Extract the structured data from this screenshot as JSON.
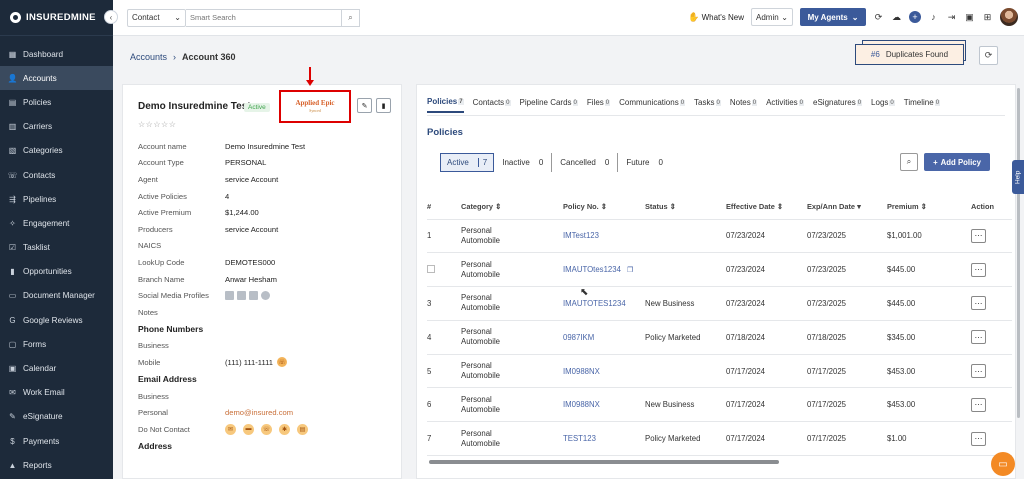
{
  "app": {
    "logo_text": "INSUREDMINE"
  },
  "sidebar": {
    "items": [
      {
        "label": "Dashboard",
        "icon": "dashboard-icon",
        "glyph": "▦"
      },
      {
        "label": "Accounts",
        "icon": "accounts-icon",
        "glyph": "👤",
        "active": true
      },
      {
        "label": "Policies",
        "icon": "policies-icon",
        "glyph": "▤"
      },
      {
        "label": "Carriers",
        "icon": "carriers-icon",
        "glyph": "▥"
      },
      {
        "label": "Categories",
        "icon": "categories-icon",
        "glyph": "▧"
      },
      {
        "label": "Contacts",
        "icon": "contacts-icon",
        "glyph": "☏"
      },
      {
        "label": "Pipelines",
        "icon": "pipelines-icon",
        "glyph": "⇶"
      },
      {
        "label": "Engagement",
        "icon": "engagement-icon",
        "glyph": "✧"
      },
      {
        "label": "Tasklist",
        "icon": "tasklist-icon",
        "glyph": "☑"
      },
      {
        "label": "Opportunities",
        "icon": "opportunities-icon",
        "glyph": "▮"
      },
      {
        "label": "Document Manager",
        "icon": "folder-icon",
        "glyph": "▭"
      },
      {
        "label": "Google Reviews",
        "icon": "google-icon",
        "glyph": "G"
      },
      {
        "label": "Forms",
        "icon": "forms-icon",
        "glyph": "▢"
      },
      {
        "label": "Calendar",
        "icon": "calendar-icon",
        "glyph": "▣"
      },
      {
        "label": "Work Email",
        "icon": "mail-icon",
        "glyph": "✉"
      },
      {
        "label": "eSignature",
        "icon": "signature-icon",
        "glyph": "✎"
      },
      {
        "label": "Payments",
        "icon": "payments-icon",
        "glyph": "$"
      },
      {
        "label": "Reports",
        "icon": "reports-icon",
        "glyph": "▲"
      }
    ]
  },
  "topbar": {
    "contact_select": "Contact",
    "search_placeholder": "Smart Search",
    "whats_new": "What's New",
    "admin_select": "Admin",
    "my_agents": "My Agents"
  },
  "breadcrumb": {
    "parent": "Accounts",
    "separator": "›",
    "current": "Account 360"
  },
  "duplicates": {
    "count": "#6",
    "label": "Duplicates Found"
  },
  "account": {
    "name": "Demo Insuredmine Test",
    "status": "Active",
    "stars": "☆☆☆☆☆",
    "carrier_logo_text": "Applied Epic",
    "carrier_logo_sub": "Synced",
    "fields": [
      {
        "k": "Account name",
        "v": "Demo Insuredmine Test"
      },
      {
        "k": "Account Type",
        "v": "PERSONAL"
      },
      {
        "k": "Agent",
        "v": "service Account"
      },
      {
        "k": "Active Policies",
        "v": "4"
      },
      {
        "k": "Active Premium",
        "v": "$1,244.00"
      },
      {
        "k": "Producers",
        "v": "service Account"
      },
      {
        "k": "NAICS",
        "v": ""
      },
      {
        "k": "LookUp Code",
        "v": "DEMOTES000"
      },
      {
        "k": "Branch Name",
        "v": "Anwar Hesham"
      },
      {
        "k": "Social Media Profiles",
        "v": ""
      },
      {
        "k": "Notes",
        "v": ""
      }
    ],
    "phone_section": "Phone Numbers",
    "phone_business": "Business",
    "phone_mobile_label": "Mobile",
    "phone_mobile": "(111) 111-1111",
    "email_section": "Email Address",
    "email_business": "Business",
    "email_personal_label": "Personal",
    "email_personal": "demo@insured.com",
    "dnc_label": "Do Not Contact",
    "address_section": "Address"
  },
  "tabs": [
    {
      "label": "Policies",
      "count": "7",
      "active": true
    },
    {
      "label": "Contacts",
      "count": "0"
    },
    {
      "label": "Pipeline Cards",
      "count": "0"
    },
    {
      "label": "Files",
      "count": "0"
    },
    {
      "label": "Communications",
      "count": "0"
    },
    {
      "label": "Tasks",
      "count": "0"
    },
    {
      "label": "Notes",
      "count": "0"
    },
    {
      "label": "Activities",
      "count": "0"
    },
    {
      "label": "eSignatures",
      "count": "0"
    },
    {
      "label": "Logs",
      "count": "0"
    },
    {
      "label": "Timeline",
      "count": "0"
    }
  ],
  "policies": {
    "title": "Policies",
    "filters": [
      {
        "label": "Active",
        "count": "7",
        "active": true
      },
      {
        "label": "Inactive",
        "count": "0"
      },
      {
        "label": "Cancelled",
        "count": "0"
      },
      {
        "label": "Future",
        "count": "0"
      }
    ],
    "add_label": "Add Policy",
    "columns": [
      "#",
      "Category ⇕",
      "Policy No. ⇕",
      "Status ⇕",
      "Effective Date ⇕",
      "Exp/Ann Date ▾",
      "Premium ⇕",
      "Action"
    ],
    "rows": [
      {
        "num": "1",
        "cat1": "Personal",
        "cat2": "Automobile",
        "policy": "IMTest123",
        "status": "",
        "eff": "07/23/2024",
        "exp": "07/23/2025",
        "premium": "$1,001.00"
      },
      {
        "num": "",
        "checkbox": true,
        "cat1": "Personal",
        "cat2": "Automobile",
        "policy": "IMAUTOtes1234",
        "copy": true,
        "status": "",
        "eff": "07/23/2024",
        "exp": "07/23/2025",
        "premium": "$445.00"
      },
      {
        "num": "3",
        "cat1": "Personal",
        "cat2": "Automobile",
        "policy": "IMAUTOTES1234",
        "status": "New Business",
        "eff": "07/23/2024",
        "exp": "07/23/2025",
        "premium": "$445.00"
      },
      {
        "num": "4",
        "cat1": "Personal",
        "cat2": "Automobile",
        "policy": "0987IKM",
        "status": "Policy Marketed",
        "eff": "07/18/2024",
        "exp": "07/18/2025",
        "premium": "$345.00"
      },
      {
        "num": "5",
        "cat1": "Personal",
        "cat2": "Automobile",
        "policy": "IM0988NX",
        "status": "",
        "eff": "07/17/2024",
        "exp": "07/17/2025",
        "premium": "$453.00"
      },
      {
        "num": "6",
        "cat1": "Personal",
        "cat2": "Automobile",
        "policy": "IM0988NX",
        "status": "New Business",
        "eff": "07/17/2024",
        "exp": "07/17/2025",
        "premium": "$453.00"
      },
      {
        "num": "7",
        "cat1": "Personal",
        "cat2": "Automobile",
        "policy": "TEST123",
        "status": "Policy Marketed",
        "eff": "07/17/2024",
        "exp": "07/17/2025",
        "premium": "$1.00"
      }
    ]
  },
  "help_label": "Help",
  "colors": {
    "sidebar": "#1d2a3a",
    "accent": "#3b5a9a",
    "link": "#4a66a8",
    "highlight": "#dd0000"
  }
}
